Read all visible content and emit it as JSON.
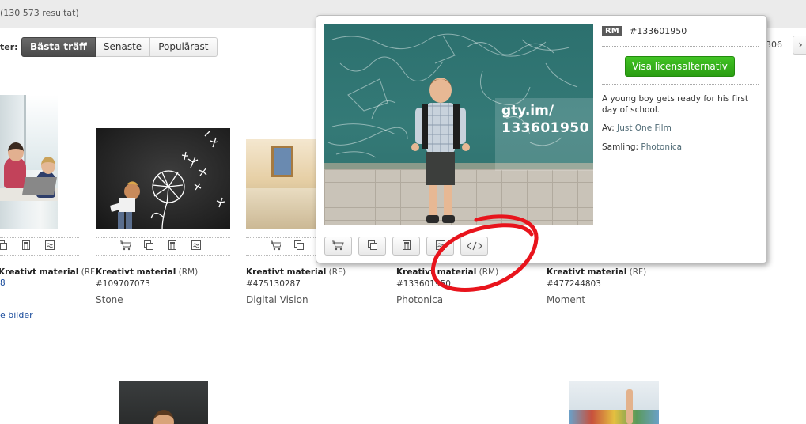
{
  "header": {
    "result_count": "(130 573 resultat)"
  },
  "sort": {
    "label": "ter:",
    "options": [
      "Bästa träff",
      "Senaste",
      "Populärast"
    ],
    "active_index": 0
  },
  "pagination": {
    "page_number": "306",
    "next_icon": "chevron-right-icon"
  },
  "results": [
    {
      "title": "Kreativt material",
      "license": "(RF)",
      "id": "",
      "collection": "",
      "more_link": "e bilder",
      "blue_id": "8"
    },
    {
      "title": "Kreativt material",
      "license": "(RM)",
      "id": "#109707073",
      "collection": "Stone"
    },
    {
      "title": "Kreativt material",
      "license": "(RF)",
      "id": "#475130287",
      "collection": "Digital Vision"
    },
    {
      "title": "Kreativt material",
      "license": "(RM)",
      "id": "#133601950",
      "collection": "Photonica"
    },
    {
      "title": "Kreativt material",
      "license": "(RF)",
      "id": "#477244803",
      "collection": "Moment"
    }
  ],
  "popup": {
    "badge": "RM",
    "image_id": "#133601950",
    "license_button": "Visa licensalternativ",
    "description": "A young boy gets ready for his first day of school.",
    "by_label": "Av:",
    "by_value": "Just One Film",
    "collection_label": "Samling:",
    "collection_value": "Photonica",
    "watermark_line1": "gty.im/",
    "watermark_line2": "133601950",
    "buttons": [
      "add-to-cart-icon",
      "lightbox-icon",
      "calculator-icon",
      "similar-icon",
      "embed-code-icon"
    ]
  },
  "colors": {
    "accent_green": "#2b9e13",
    "annotation_red": "#e8141c",
    "link_blue": "#1a4c9c"
  }
}
